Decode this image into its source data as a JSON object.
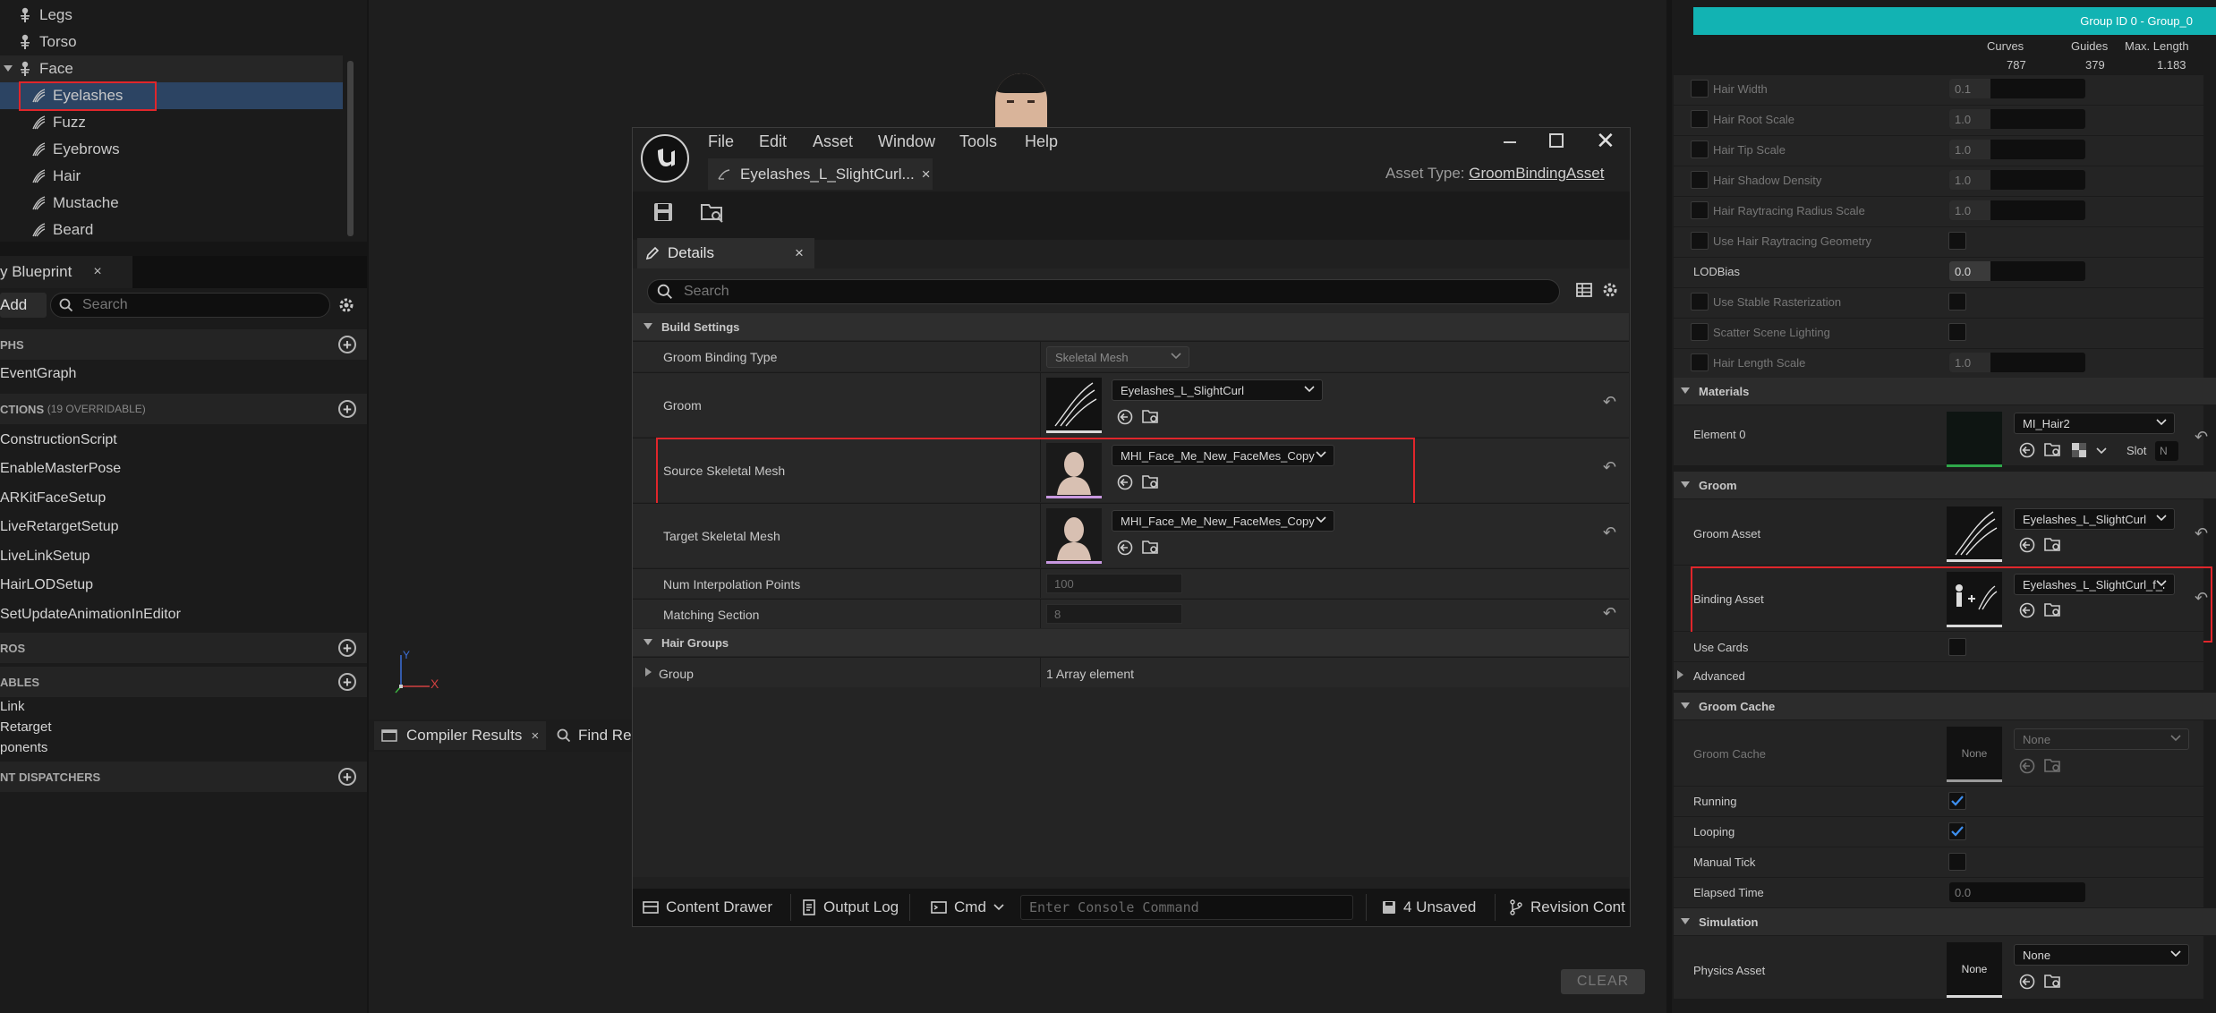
{
  "outliner": {
    "items": [
      {
        "label": "Legs",
        "icon": "skeleton-icon"
      },
      {
        "label": "Torso",
        "icon": "skeleton-icon"
      },
      {
        "label": "Face",
        "icon": "skeleton-icon"
      },
      {
        "label": "Eyelashes",
        "icon": "groom-icon"
      },
      {
        "label": "Fuzz",
        "icon": "groom-icon"
      },
      {
        "label": "Eyebrows",
        "icon": "groom-icon"
      },
      {
        "label": "Hair",
        "icon": "groom-icon"
      },
      {
        "label": "Mustache",
        "icon": "groom-icon"
      },
      {
        "label": "Beard",
        "icon": "groom-icon"
      }
    ]
  },
  "blueprint": {
    "tab_label": "y Blueprint",
    "add_label": "Add",
    "search_placeholder": "Search",
    "sections": {
      "graphs": "PHS",
      "functions": "CTIONS",
      "functions_count": "(19 OVERRIDABLE)",
      "macros": "ROS",
      "variables": "ABLES",
      "dispatchers": "NT DISPATCHERS"
    },
    "graphs": [
      "EventGraph"
    ],
    "functions": [
      "ConstructionScript",
      "EnableMasterPose",
      "ARKitFaceSetup",
      "LiveRetargetSetup",
      "LiveLinkSetup",
      "HairLODSetup",
      "SetUpdateAnimationInEditor"
    ],
    "variables": [
      "Link",
      "Retarget",
      "ponents"
    ]
  },
  "viewport": {
    "compiler_tab": "Compiler Results",
    "find_tab": "Find Re",
    "clear_label": "CLEAR",
    "axis_x": "X",
    "axis_y": "Y"
  },
  "dialog": {
    "menus": [
      "File",
      "Edit",
      "Asset",
      "Window",
      "Tools",
      "Help"
    ],
    "asset_tab": "Eyelashes_L_SlightCurl...",
    "asset_type_label": "Asset Type:",
    "asset_type_value": "GroomBindingAsset",
    "details_tab": "Details",
    "search_placeholder": "Search",
    "build_settings": "Build Settings",
    "props": {
      "groom_binding_type_label": "Groom Binding Type",
      "groom_binding_type_value": "Skeletal Mesh",
      "groom_label": "Groom",
      "groom_value": "Eyelashes_L_SlightCurl",
      "source_mesh_label": "Source Skeletal Mesh",
      "source_mesh_value": "MHI_Face_Me_New_FaceMes_Copy",
      "target_mesh_label": "Target Skeletal Mesh",
      "target_mesh_value": "MHI_Face_Me_New_FaceMes_Copy",
      "num_interp_label": "Num Interpolation Points",
      "num_interp_value": "100",
      "matching_label": "Matching Section",
      "matching_value": "8"
    },
    "hair_groups": "Hair Groups",
    "group_label": "Group",
    "group_value": "1 Array element",
    "status": {
      "content_drawer": "Content Drawer",
      "output_log": "Output Log",
      "cmd": "Cmd",
      "console_placeholder": "Enter Console Command",
      "unsaved": "4 Unsaved",
      "revision": "Revision Cont"
    }
  },
  "rpanel": {
    "group_header": "Group ID 0 - Group_0",
    "stats_headers": [
      "Curves",
      "Guides",
      "Max. Length"
    ],
    "stats_values": [
      "787",
      "379",
      "1.183"
    ],
    "hair_props": [
      {
        "label": "Hair Width",
        "value": "0.1"
      },
      {
        "label": "Hair Root Scale",
        "value": "1.0"
      },
      {
        "label": "Hair Tip Scale",
        "value": "1.0"
      },
      {
        "label": "Hair Shadow Density",
        "value": "1.0"
      },
      {
        "label": "Hair Raytracing Radius Scale",
        "value": "1.0"
      }
    ],
    "use_raytracing": "Use Hair Raytracing Geometry",
    "lod_bias_label": "LODBias",
    "lod_bias_value": "0.0",
    "use_stable": "Use Stable Rasterization",
    "scatter": "Scatter Scene Lighting",
    "hair_length_label": "Hair Length Scale",
    "hair_length_value": "1.0",
    "materials": "Materials",
    "element0": "Element 0",
    "material_value": "MI_Hair2",
    "slot_label": "Slot",
    "slot_value": "N",
    "groom": "Groom",
    "groom_asset_label": "Groom Asset",
    "groom_asset_value": "Eyelashes_L_SlightCurl",
    "binding_asset_label": "Binding Asset",
    "binding_asset_value": "Eyelashes_L_SlightCurl_f_r",
    "use_cards": "Use Cards",
    "advanced": "Advanced",
    "groom_cache": "Groom Cache",
    "groom_cache_label": "Groom Cache",
    "groom_cache_thumb": "None",
    "groom_cache_value": "None",
    "running": "Running",
    "looping": "Looping",
    "manual_tick": "Manual Tick",
    "elapsed_label": "Elapsed Time",
    "elapsed_value": "0.0",
    "simulation": "Simulation",
    "physics_label": "Physics Asset",
    "physics_thumb": "None",
    "physics_value": "None"
  },
  "colors": {
    "accent": "#12b3b3",
    "selection": "#2c4463",
    "highlight": "#e0262b",
    "check": "#3d8ff0"
  }
}
